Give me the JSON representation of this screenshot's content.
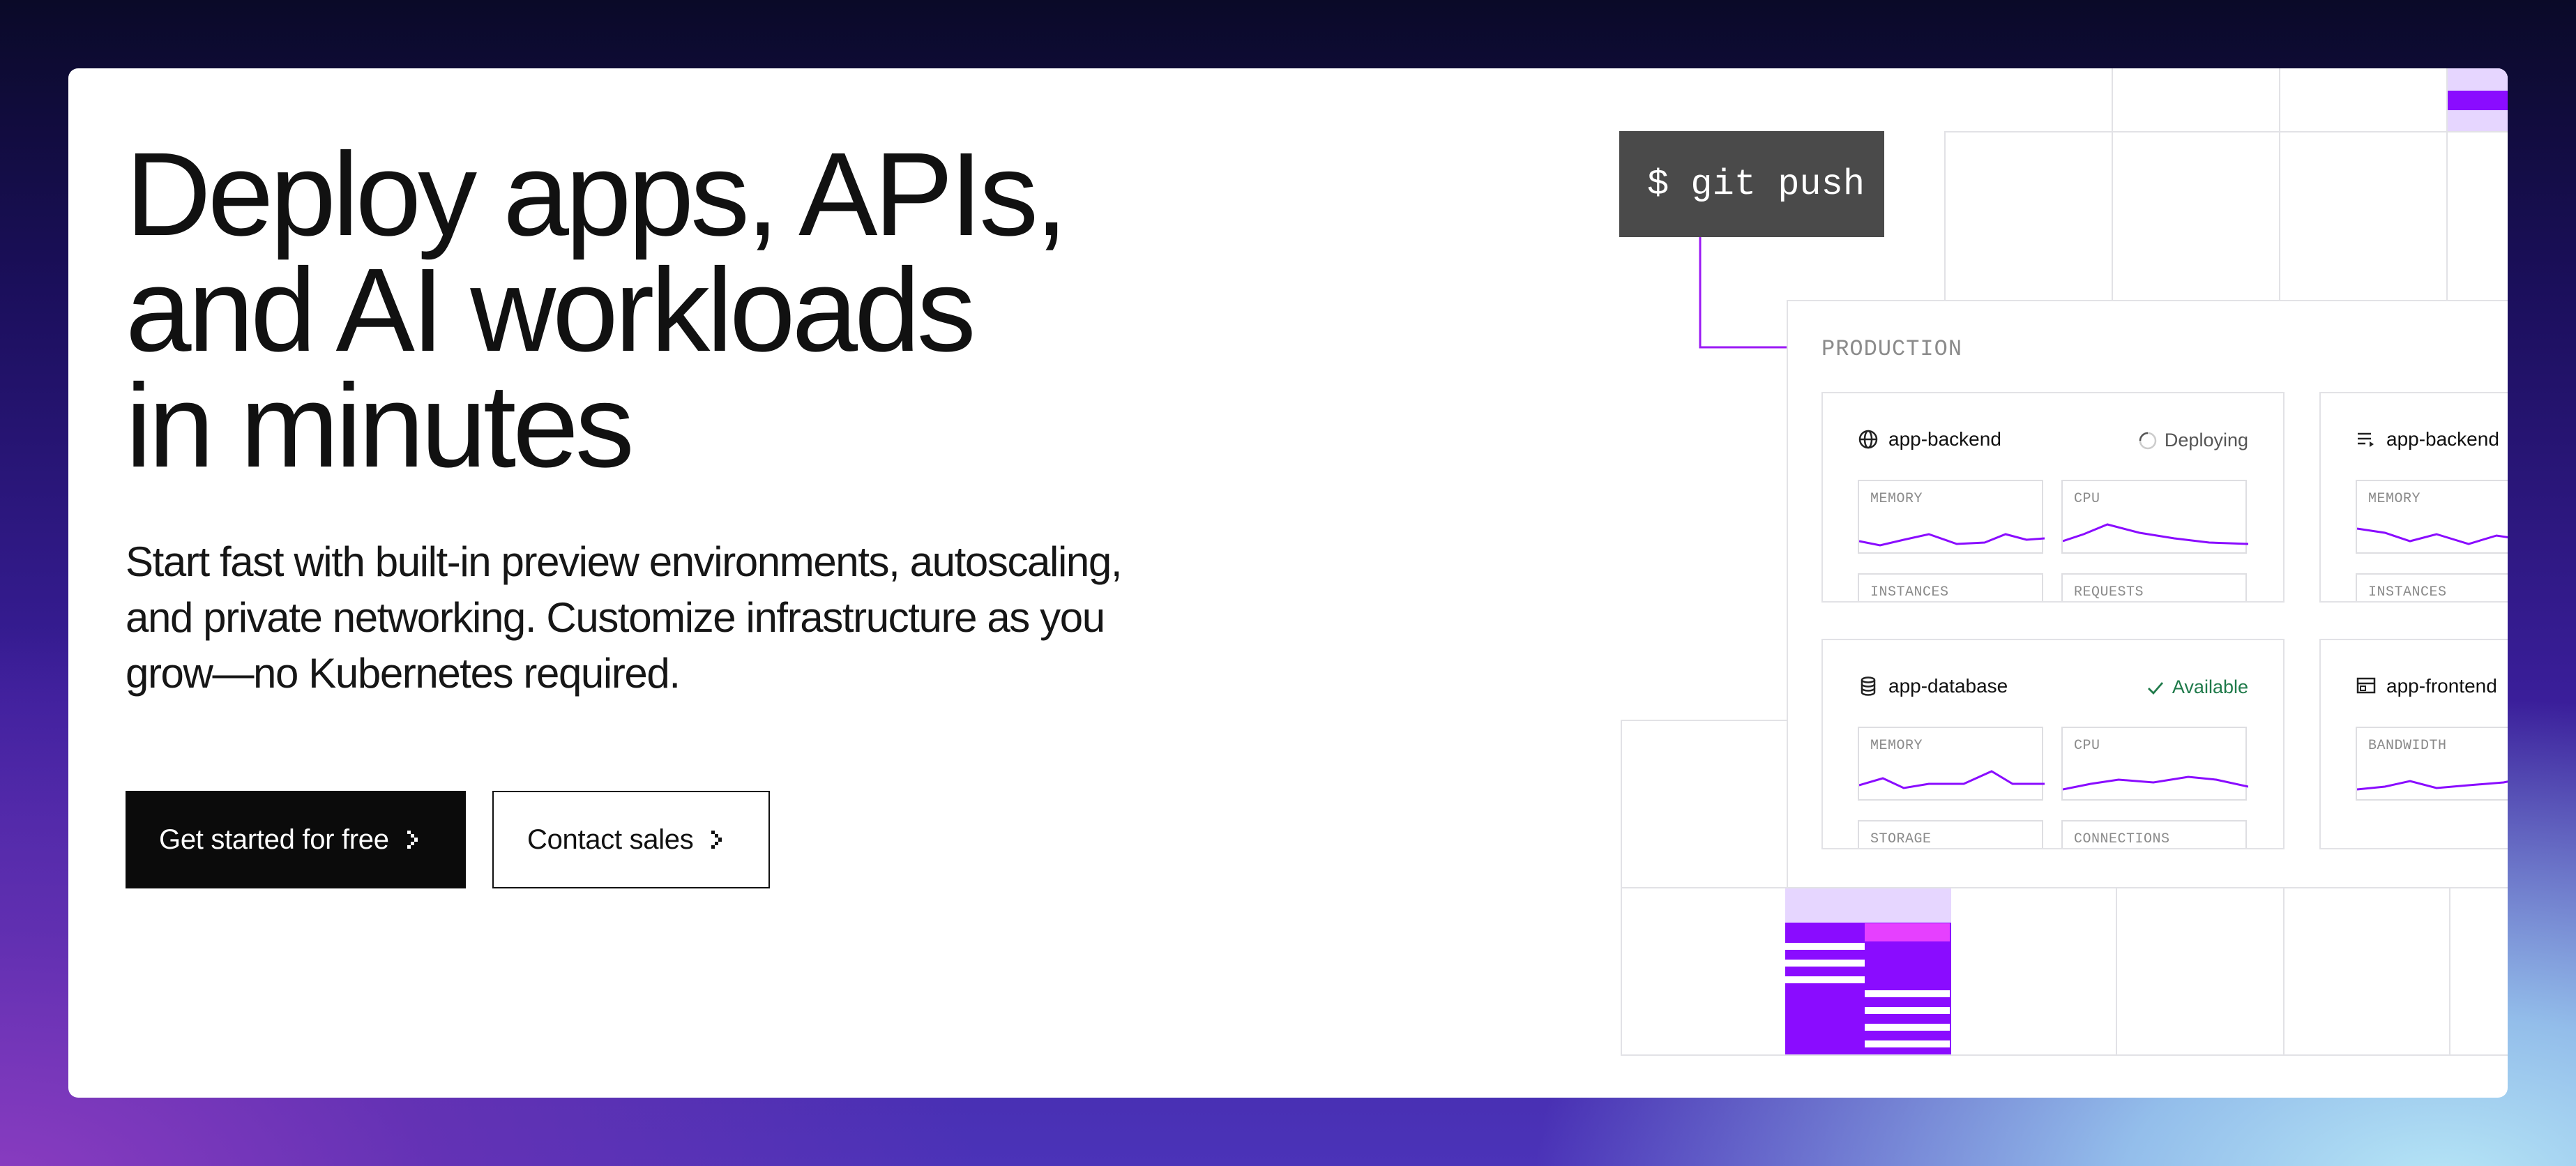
{
  "hero": {
    "headline_lines": [
      "Deploy apps, APIs,",
      "and AI workloads",
      "in minutes"
    ],
    "subheadline_lines": [
      "Start fast with built-in preview environments, autoscaling,",
      "and private networking. Customize infrastructure as you",
      "grow—no Kubernetes required."
    ],
    "primary_cta": {
      "label": "Get started for free",
      "icon": "chevron-right-icon"
    },
    "secondary_cta": {
      "label": "Contact sales",
      "icon": "chevron-right-icon"
    }
  },
  "illustration": {
    "terminal_command": "$ git push",
    "environment_label": "PRODUCTION",
    "accent_color": "#8a0cff",
    "services": [
      {
        "name": "app-backend",
        "icon": "globe-icon",
        "status": "Deploying",
        "status_icon": "spinner-icon",
        "metrics": [
          "MEMORY",
          "CPU"
        ],
        "more_metrics": [
          "INSTANCES",
          "REQUESTS"
        ]
      },
      {
        "name": "app-backend",
        "icon": "worker-list-icon",
        "metrics": [
          "MEMORY"
        ],
        "more_metrics": [
          "INSTANCES"
        ]
      },
      {
        "name": "app-database",
        "icon": "database-icon",
        "status": "Available",
        "status_icon": "check-icon",
        "status_color": "#1f7a4a",
        "metrics": [
          "MEMORY",
          "CPU"
        ],
        "more_metrics": [
          "STORAGE",
          "CONNECTIONS"
        ]
      },
      {
        "name": "app-frontend",
        "icon": "static-site-icon",
        "metrics": [
          "BANDWIDTH"
        ]
      }
    ]
  }
}
